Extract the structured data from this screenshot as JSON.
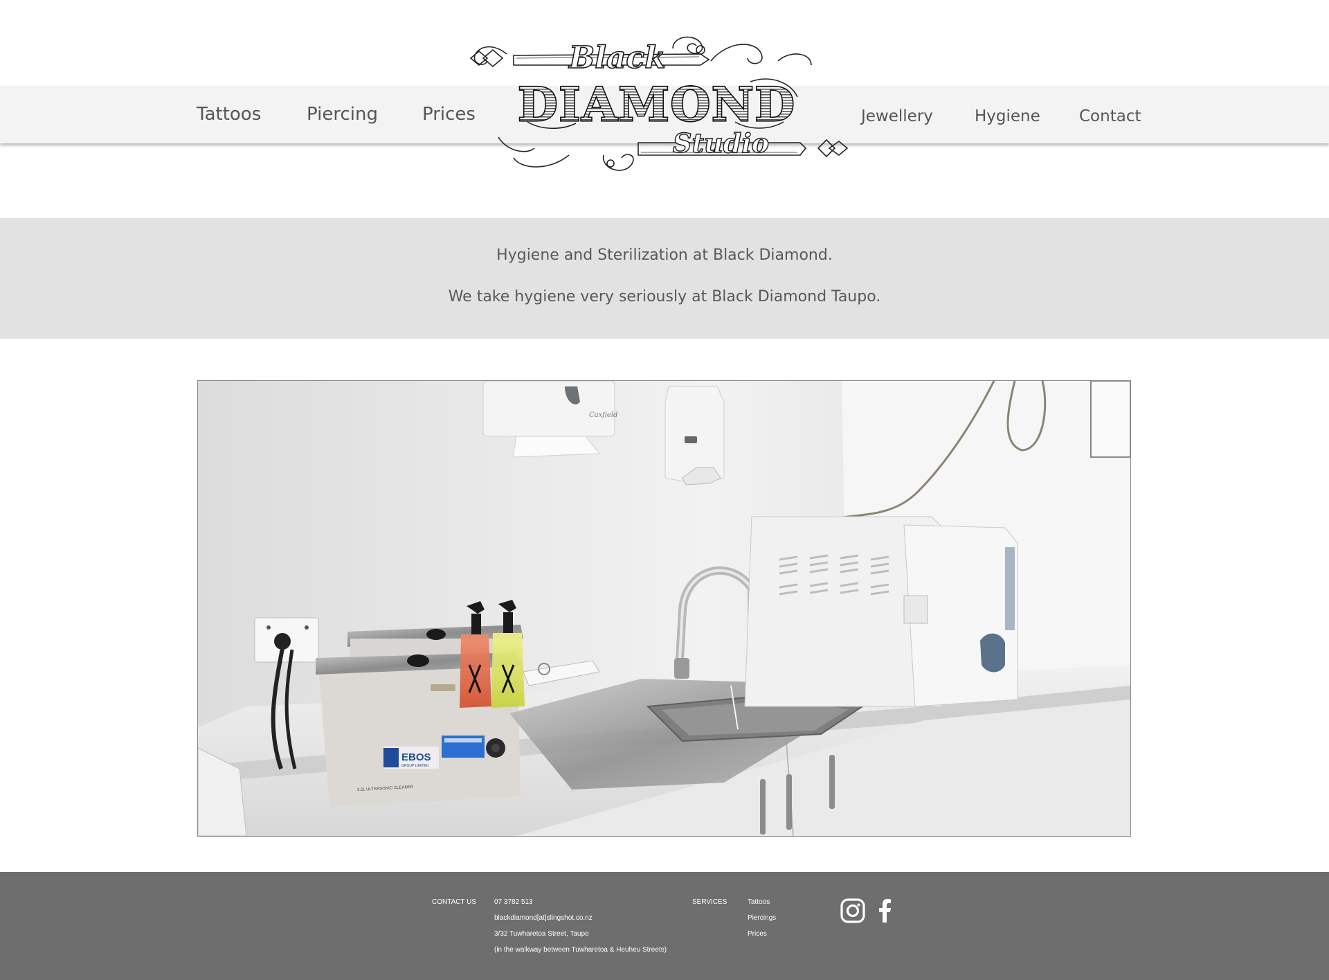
{
  "brand": {
    "logo_line1": "Black",
    "logo_line2": "DIAMOND",
    "logo_line3": "Studio"
  },
  "nav": {
    "left": [
      "Tattoos",
      "Piercing",
      "Prices"
    ],
    "right": [
      "Jewellery",
      "Hygiene",
      "Contact"
    ]
  },
  "intro": {
    "heading": "Hygiene and Sterilization at Black Diamond.",
    "text": "We take hygiene very seriously at Black Diamond Taupo."
  },
  "photo": {
    "dispenser_brand": "Caxfield",
    "cleaner_brand": "EBOS",
    "cleaner_subtitle": "GROUP LIMITED",
    "cleaner_label": "3.2L ULTRASONIC CLEANER"
  },
  "footer": {
    "contact_label": "CONTACT US",
    "phone": "07 3782 513",
    "email": "blackdiamond[at]slingshot.co.nz",
    "address": "3/32 Tuwharetoa Street, Taupo",
    "address_note": "(in the walkway between Tuwharetoa & Heuheu Streets)",
    "services_label": "SERVICES",
    "services": [
      "Tattoos",
      "Piercings",
      "Prices"
    ],
    "social": [
      "instagram-icon",
      "facebook-icon"
    ]
  },
  "colors": {
    "nav_bg": "#f3f3f3",
    "intro_bg": "#e2e2e2",
    "footer_bg": "#6e6e6e",
    "text": "#555555"
  }
}
